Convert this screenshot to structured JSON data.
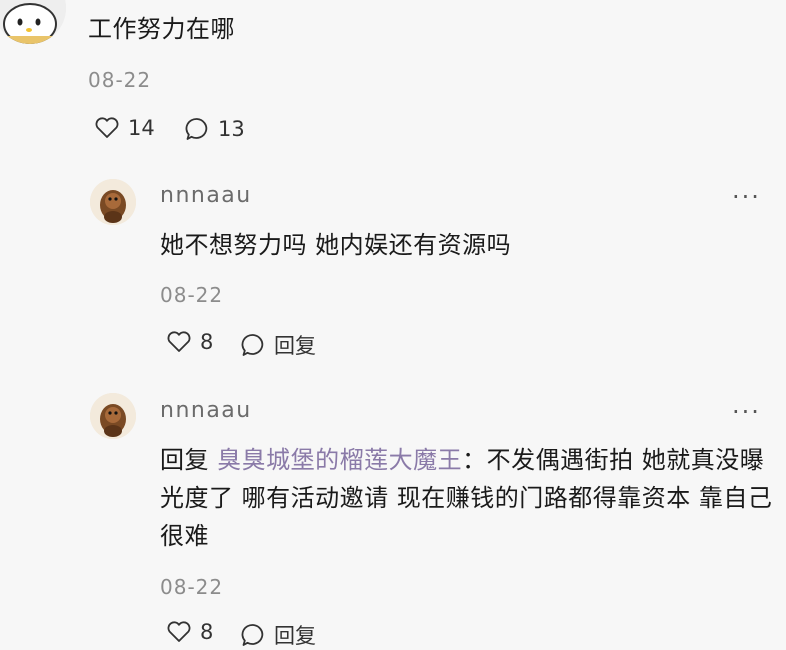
{
  "main_comment": {
    "text": "工作努力在哪",
    "date": "08-22",
    "likes": "14",
    "comments": "13"
  },
  "replies": [
    {
      "username": "nnnaau",
      "more": "···",
      "text": "她不想努力吗 她内娱还有资源吗",
      "date": "08-22",
      "likes": "8",
      "reply_label": "回复"
    },
    {
      "username": "nnnaau",
      "more": "···",
      "prefix": "回复 ",
      "mention": "臭臭城堡的榴莲大魔王",
      "text": "：不发偶遇街拍 她就真没曝光度了 哪有活动邀请 现在赚钱的门路都得靠资本 靠自己很难",
      "date": "08-22",
      "likes": "8",
      "reply_label": "回复"
    }
  ],
  "icons": {
    "like": "heart-outline-icon",
    "comment": "speech-bubble-icon",
    "more": "more-dots-icon"
  }
}
